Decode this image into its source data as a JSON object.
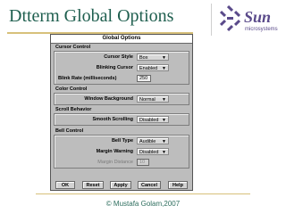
{
  "slide": {
    "title": "Dtterm Global Options",
    "footer": "© Mustafa Golam,2007",
    "logo_text": "microsystems"
  },
  "dialog": {
    "title": "Global Options",
    "groups": {
      "cursor_control": {
        "label": "Cursor Control",
        "cursor_style": {
          "label": "Cursor Style",
          "value": "Box"
        },
        "blinking_cursor": {
          "label": "Blinking Cursor",
          "value": "Enabled"
        },
        "blink_rate": {
          "label": "Blink Rate (milliseconds)",
          "value": "250"
        }
      },
      "color_control": {
        "label": "Color Control",
        "window_background": {
          "label": "Window Background",
          "value": "Normal"
        }
      },
      "scroll_behavior": {
        "label": "Scroll Behavior",
        "smooth_scrolling": {
          "label": "Smooth Scrolling",
          "value": "Disabled"
        }
      },
      "bell_control": {
        "label": "Bell Control",
        "bell_type": {
          "label": "Bell Type",
          "value": "Audible"
        },
        "margin_warning": {
          "label": "Margin Warning",
          "value": "Disabled"
        },
        "margin_distance": {
          "label": "Margin Distance",
          "value": "10"
        }
      }
    },
    "buttons": {
      "ok": "OK",
      "reset": "Reset",
      "apply": "Apply",
      "cancel": "Cancel",
      "help": "Help"
    }
  },
  "colors": {
    "title": "#1f5f4f",
    "rule": "#d7c07a",
    "dialog_bg": "#bdbdbd",
    "logo": "#5a4a8a"
  },
  "icons": {
    "logo": "sun-logo-icon",
    "menu_arrow": "menu-arrow-icon"
  }
}
